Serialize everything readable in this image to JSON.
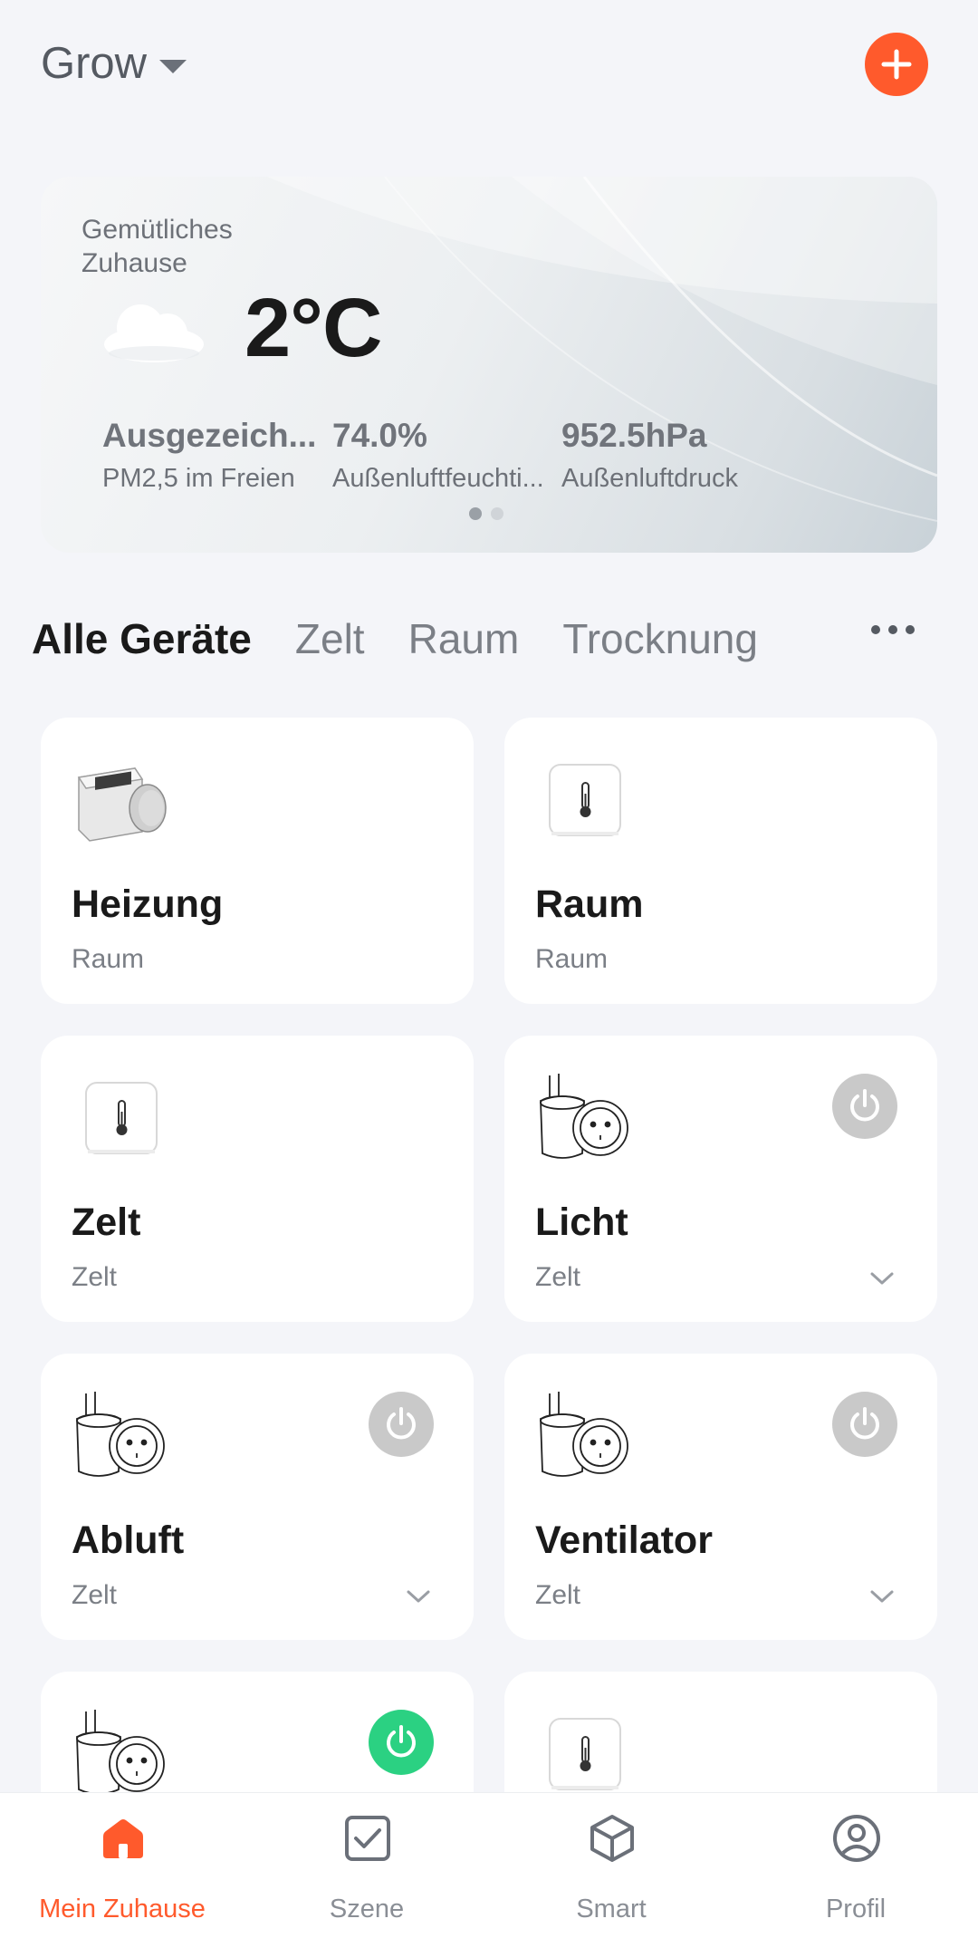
{
  "header": {
    "home_name": "Grow"
  },
  "weather": {
    "place": "Gemütliches Zuhause",
    "temperature": "2°C",
    "metrics": [
      {
        "value": "Ausgezeich...",
        "label": "PM2,5 im Freien"
      },
      {
        "value": "74.0%",
        "label": "Außenluftfeuchti..."
      },
      {
        "value": "952.5hPa",
        "label": "Außenluftdruck"
      }
    ],
    "page_indicator": {
      "count": 2,
      "active": 1
    }
  },
  "tabs": [
    "Alle Geräte",
    "Zelt",
    "Raum",
    "Trocknung"
  ],
  "devices": [
    {
      "name": "Heizung",
      "room": "Raum",
      "icon": "thermostat-valve-icon"
    },
    {
      "name": "Raum",
      "room": "Raum",
      "icon": "thermometer-sensor-icon"
    },
    {
      "name": "Zelt",
      "room": "Zelt",
      "icon": "thermometer-sensor-icon"
    },
    {
      "name": "Licht",
      "room": "Zelt",
      "icon": "smart-plug-icon",
      "power": "off"
    },
    {
      "name": "Abluft",
      "room": "Zelt",
      "icon": "smart-plug-icon",
      "power": "off"
    },
    {
      "name": "Ventilator",
      "room": "Zelt",
      "icon": "smart-plug-icon",
      "power": "off"
    },
    {
      "name": "",
      "room": "",
      "icon": "smart-plug-icon",
      "power": "on"
    },
    {
      "name": "",
      "room": "",
      "icon": "thermometer-sensor-icon"
    }
  ],
  "nav": {
    "items": [
      {
        "label": "Mein Zuhause",
        "icon": "home-icon"
      },
      {
        "label": "Szene",
        "icon": "checkbox-icon"
      },
      {
        "label": "Smart",
        "icon": "cube-icon"
      },
      {
        "label": "Profil",
        "icon": "profile-icon"
      }
    ]
  },
  "colors": {
    "accent": "#ff5a2c",
    "power_on": "#2bd182",
    "power_off": "#c9c9c9",
    "background": "#f4f5f9"
  }
}
